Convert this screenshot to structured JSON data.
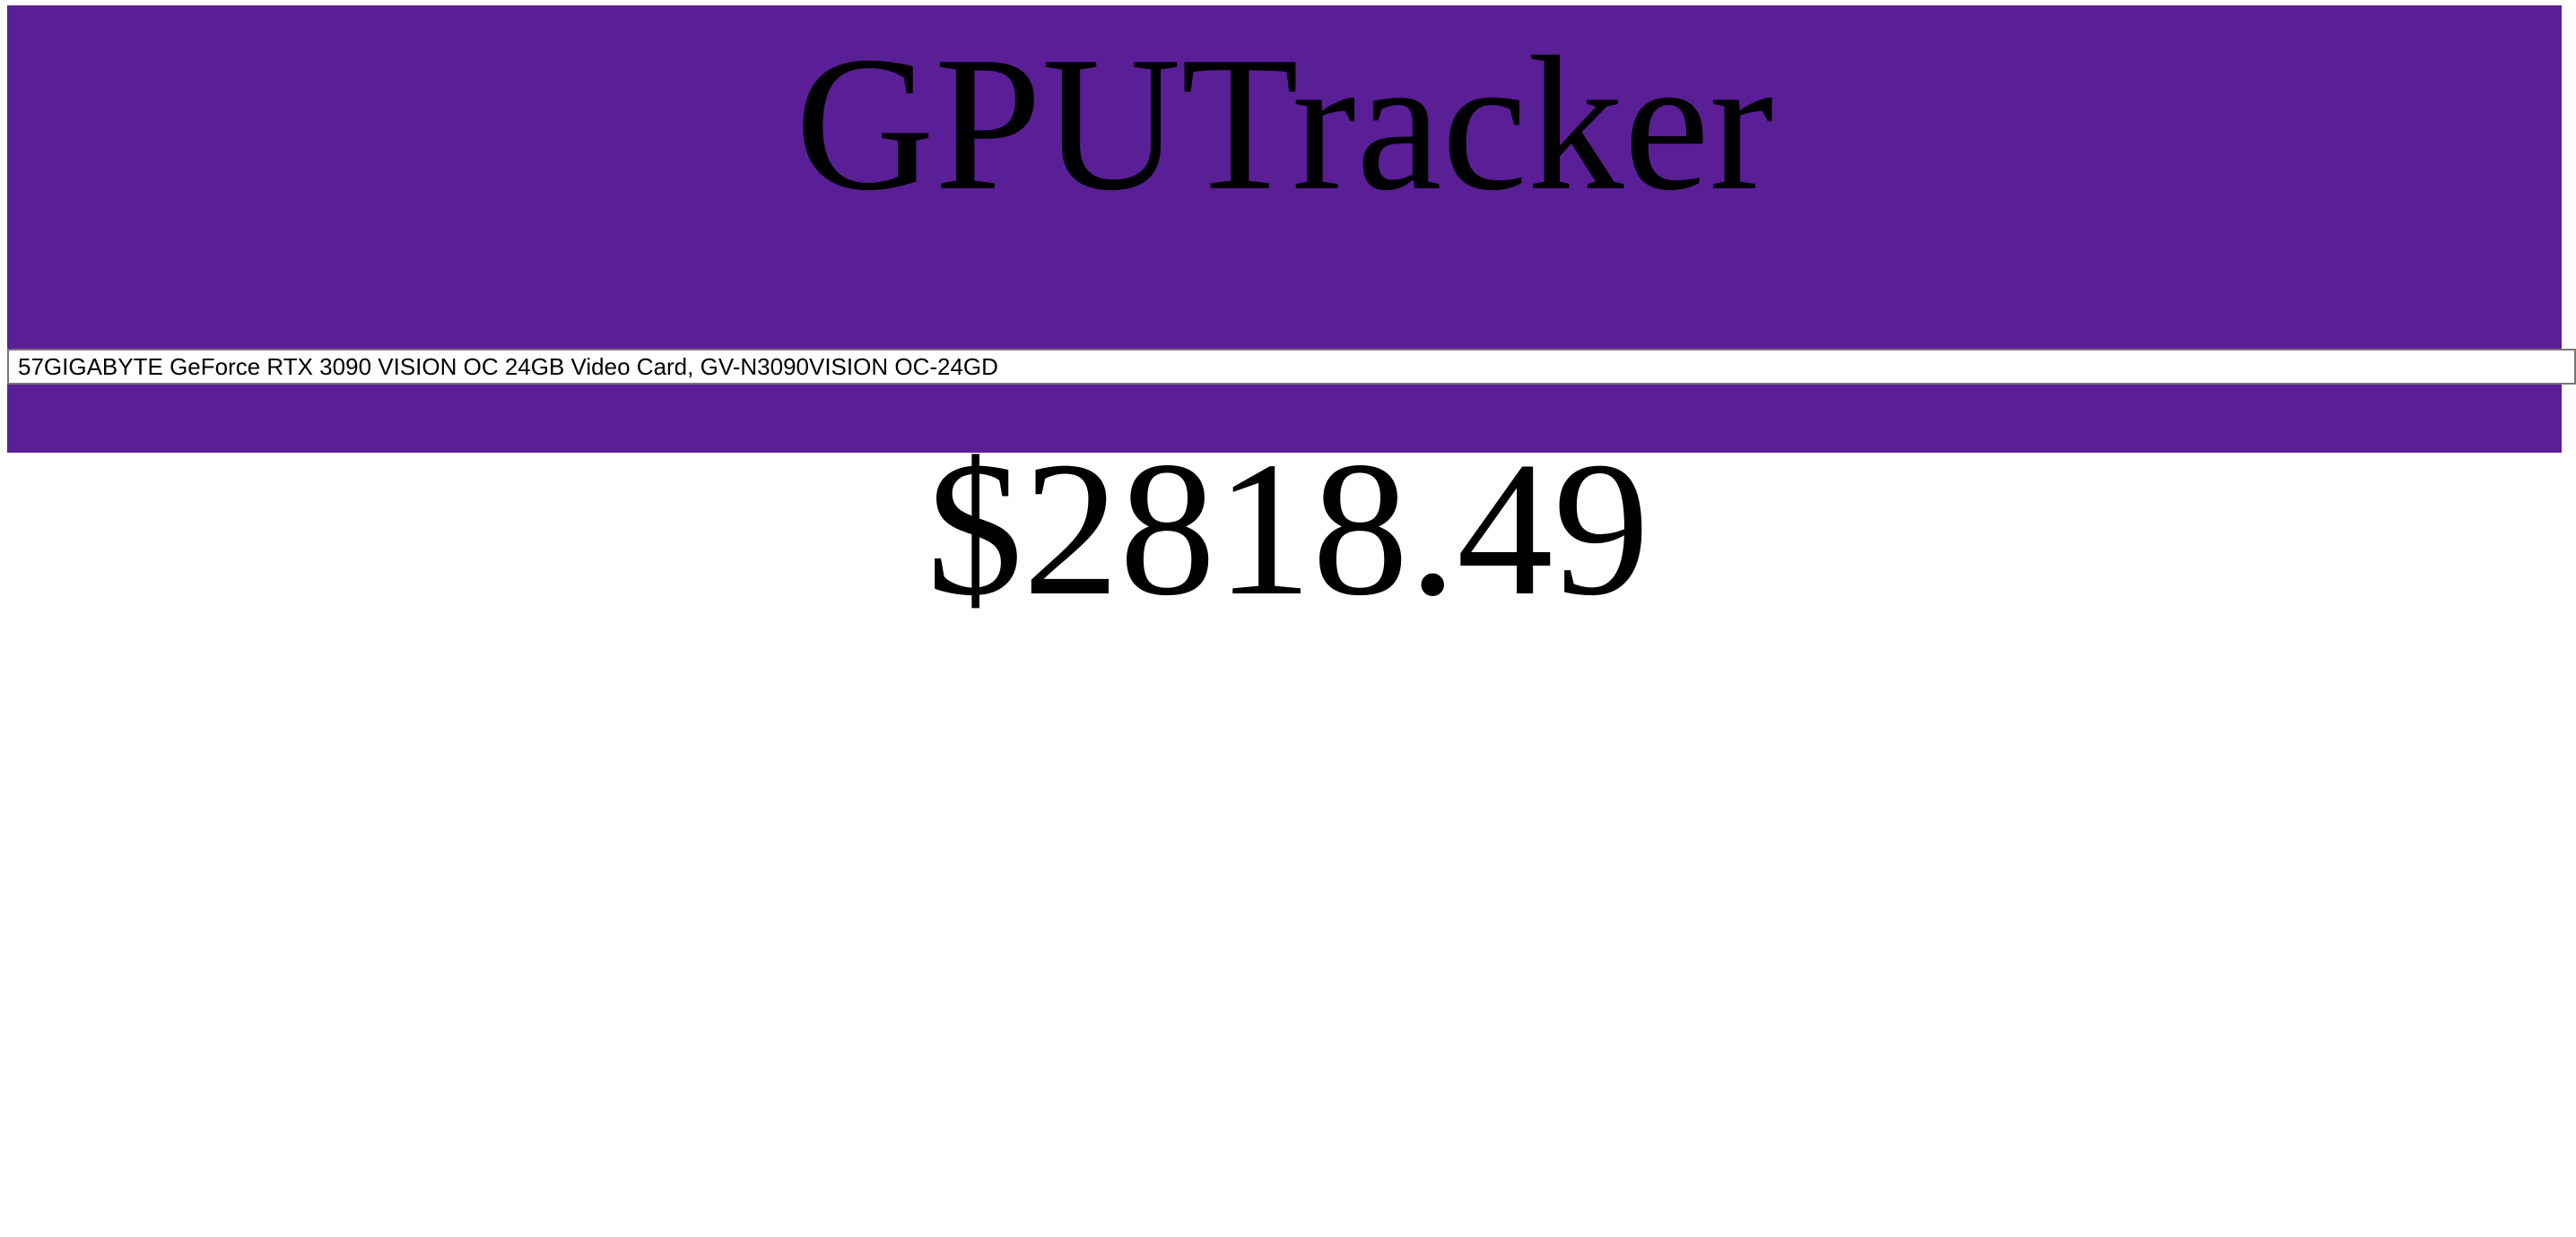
{
  "app": {
    "title": "GPUTracker"
  },
  "selector": {
    "selected_option": "57GIGABYTE GeForce RTX 3090 VISION OC 24GB Video Card, GV-N3090VISION OC-24GD"
  },
  "product": {
    "price": "$2818.49"
  },
  "colors": {
    "header_background": "#5a1f96",
    "page_background": "#ffffff"
  }
}
